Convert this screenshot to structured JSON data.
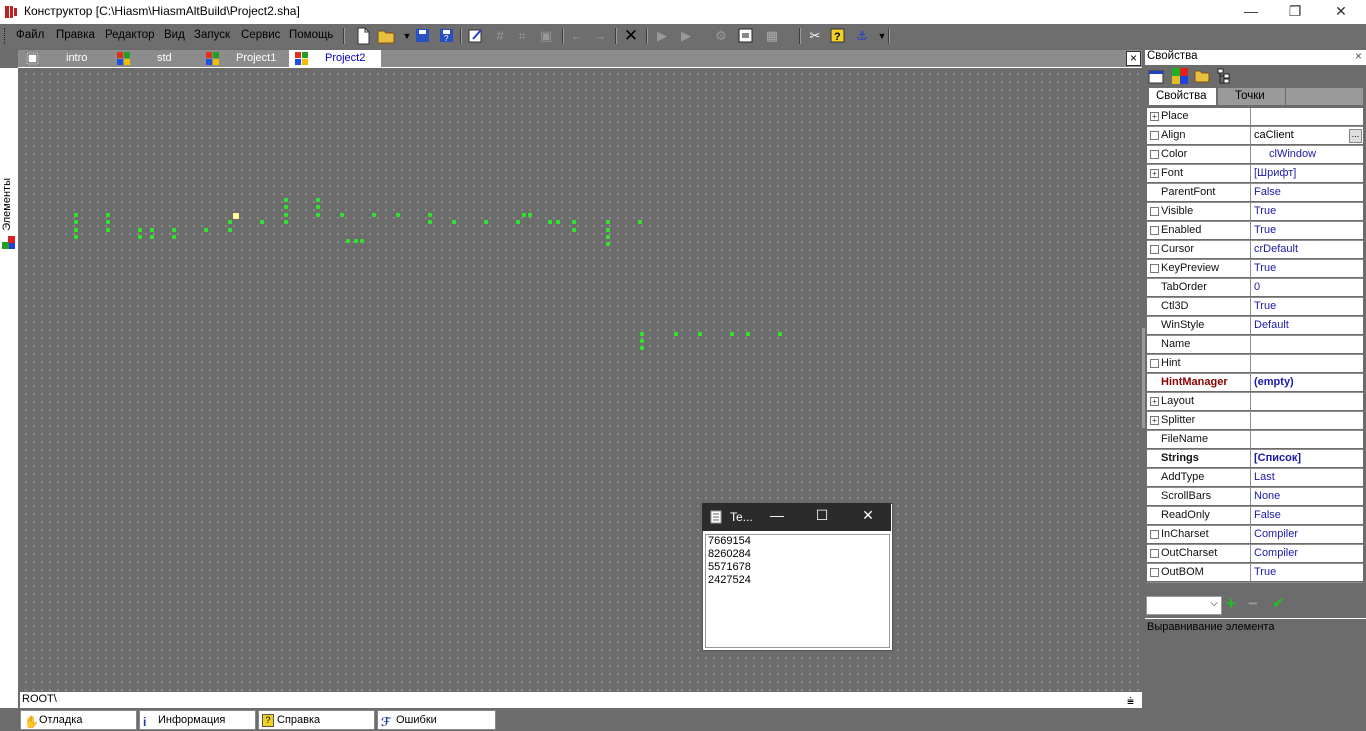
{
  "window": {
    "title": "Конструктор [C:\\Hiasm\\HiasmAltBuild\\Project2.sha]",
    "minimize": "—",
    "restore": "❐",
    "close": "✕"
  },
  "menu": [
    "Файл",
    "Правка",
    "Редактор",
    "Вид",
    "Запуск",
    "Сервис",
    "Помощь"
  ],
  "left_strip": {
    "label": "Элементы"
  },
  "tabs": [
    {
      "label": "intro",
      "active": false
    },
    {
      "label": "std",
      "active": false
    },
    {
      "label": "Project1",
      "active": false
    },
    {
      "label": "Project2",
      "active": true
    }
  ],
  "tabs_close": "×",
  "path": "ROOT\\",
  "bottom_tabs": [
    {
      "label": "Отладка",
      "icon": "hand-icon"
    },
    {
      "label": "Информация",
      "icon": "info-icon"
    },
    {
      "label": "Справка",
      "icon": "help-icon"
    },
    {
      "label": "Ошибки",
      "icon": "errors-icon"
    }
  ],
  "properties": {
    "title": "Свойства",
    "close": "×",
    "tabs": [
      "Свойства",
      "Точки"
    ],
    "rows": [
      {
        "name": "Place",
        "value": "",
        "box": "plus"
      },
      {
        "name": "Align",
        "value": "caClient",
        "box": "check",
        "dots": true
      },
      {
        "name": "Color",
        "value": "clWindow",
        "box": "check"
      },
      {
        "name": "Font",
        "value": "[Шрифт]",
        "box": "plus"
      },
      {
        "name": "ParentFont",
        "value": "False",
        "box": "none"
      },
      {
        "name": "Visible",
        "value": "True",
        "box": "check"
      },
      {
        "name": "Enabled",
        "value": "True",
        "box": "check"
      },
      {
        "name": "Cursor",
        "value": "crDefault",
        "box": "check"
      },
      {
        "name": "KeyPreview",
        "value": "True",
        "box": "check"
      },
      {
        "name": "TabOrder",
        "value": "0",
        "box": "none"
      },
      {
        "name": "Ctl3D",
        "value": "True",
        "box": "none"
      },
      {
        "name": "WinStyle",
        "value": "Default",
        "box": "none"
      },
      {
        "name": "Name",
        "value": "",
        "box": "none"
      },
      {
        "name": "Hint",
        "value": "",
        "box": "check"
      },
      {
        "name": "HintManager",
        "value": "(empty)",
        "box": "none",
        "bold": true,
        "maroon": true
      },
      {
        "name": "Layout",
        "value": "",
        "box": "plus"
      },
      {
        "name": "Splitter",
        "value": "",
        "box": "plus"
      },
      {
        "name": "FileName",
        "value": "",
        "box": "none"
      },
      {
        "name": "Strings",
        "value": "[Список]",
        "box": "none",
        "bold": true
      },
      {
        "name": "AddType",
        "value": "Last",
        "box": "none"
      },
      {
        "name": "ScrollBars",
        "value": "None",
        "box": "none"
      },
      {
        "name": "ReadOnly",
        "value": "False",
        "box": "none"
      },
      {
        "name": "InCharset",
        "value": "Compiler",
        "box": "check"
      },
      {
        "name": "OutCharset",
        "value": "Compiler",
        "box": "check"
      },
      {
        "name": "OutBOM",
        "value": "True",
        "box": "check"
      }
    ],
    "description": "Выравнивание элемента"
  },
  "popup": {
    "title": "Te...",
    "lines": [
      "7669154",
      "8260284",
      "5571678",
      "2427524"
    ]
  },
  "colors": {
    "background": "#6c6c6c",
    "element_dot": "#2ee62e",
    "selected_dot": "#ffff99",
    "value_text": "#1a1aa8",
    "active_tab_text": "#0000cc"
  }
}
